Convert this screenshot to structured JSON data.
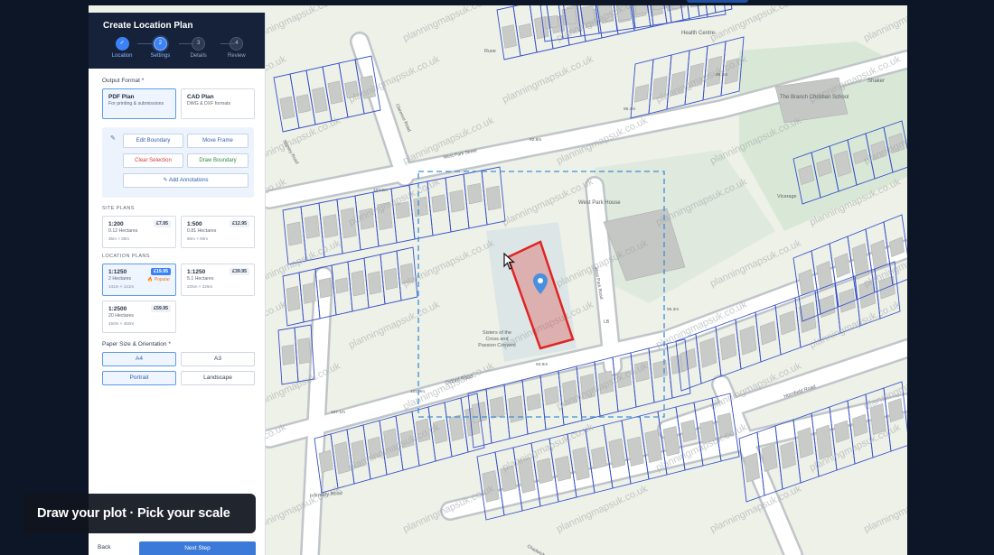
{
  "panel": {
    "title": "Create Location Plan",
    "steps": [
      {
        "num": "✓",
        "label": "Location"
      },
      {
        "num": "2",
        "label": "Settings"
      },
      {
        "num": "3",
        "label": "Details"
      },
      {
        "num": "4",
        "label": "Review"
      }
    ],
    "output_format": {
      "label": "Output Format *",
      "options": [
        {
          "title": "PDF Plan",
          "sub": "For printing & submissions",
          "selected": true
        },
        {
          "title": "CAD Plan",
          "sub": "DWG & DXF formats",
          "selected": false
        }
      ]
    },
    "tools": {
      "edit_boundary": "Edit Boundary",
      "move_frame": "Move Frame",
      "clear_selection": "Clear Selection",
      "draw_boundary": "Draw Boundary",
      "add_annotations": "Add Annotations"
    },
    "site_plans": {
      "label": "SITE PLANS",
      "items": [
        {
          "scale": "1:200",
          "area": "0.12 Hectares",
          "dim": "35m × 35m",
          "price": "£7.95"
        },
        {
          "scale": "1:500",
          "area": "0.81 Hectares",
          "dim": "90m × 90m",
          "price": "£12.95"
        }
      ]
    },
    "location_plans": {
      "label": "LOCATION PLANS",
      "items": [
        {
          "scale": "1:1250",
          "area": "2 Hectares",
          "dim": "141m × 141m",
          "price": "£19.95",
          "badge": "🔥 Popular",
          "selected": true
        },
        {
          "scale": "1:1250",
          "area": "5.1 Hectares",
          "dim": "225m × 225m",
          "price": "£39.95"
        },
        {
          "scale": "1:2500",
          "area": "20 Hectares",
          "dim": "450m × 450m",
          "price": "£59.95"
        }
      ]
    },
    "paper": {
      "label": "Paper Size & Orientation *",
      "sizes": [
        "A4",
        "A3"
      ],
      "orientations": [
        "Portrait",
        "Landscape"
      ],
      "selected_size": "A4",
      "selected_orientation": "Portrait"
    },
    "back": "Back",
    "next": "Next Step"
  },
  "caption": "Draw your plot · Pick your scale",
  "map": {
    "watermark": "planningmapsuk.co.uk",
    "zoom_in": "+",
    "labels": {
      "health_centre": "Health Centre",
      "ruse": "Ruse",
      "school": "The Branch Christian School",
      "shaker": "Shaker",
      "west_park_street": "West Park Street",
      "church_road": "Clarence Road",
      "west_park_house": "West Park House",
      "vicarage": "Vicarage",
      "sisters": "Sisters of the Cross and Passion Convent",
      "oxford_road": "Oxford Road",
      "hornfield_road": "Hornfield Road",
      "infirmary_road": "Infirmary Road",
      "chadwick": "Chadwick Road",
      "lb": "LB",
      "west_park_road": "West Park Road",
      "stonecliff": "Stanley Road"
    },
    "spot_heights": [
      "103.9m",
      "92.8m",
      "96.4m",
      "96.3m",
      "95.3m",
      "93.9m",
      "101.9m",
      "107.1m"
    ]
  },
  "colors": {
    "panel_header": "#16223a",
    "accent": "#3b82f6",
    "boundary": "#e02424",
    "frame": "#3b8fd8",
    "map_lines": "#3650c8"
  }
}
